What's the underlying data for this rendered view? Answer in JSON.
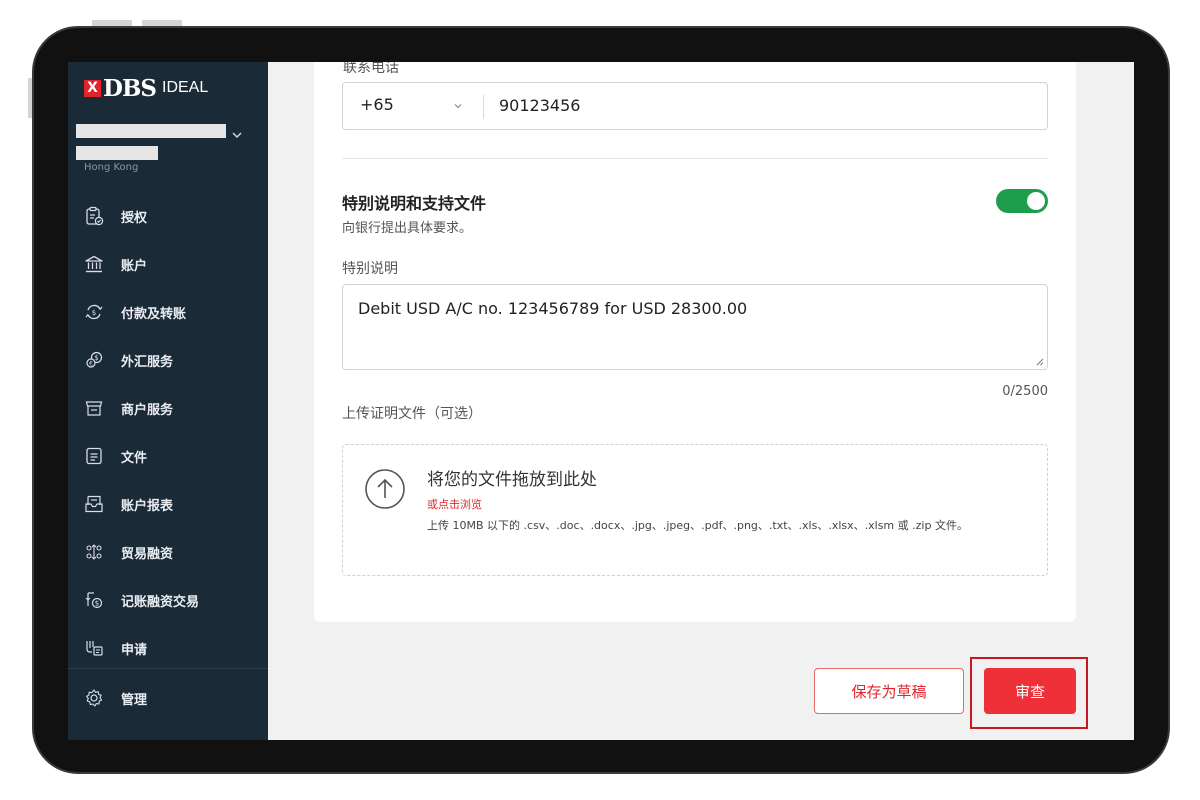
{
  "brand": {
    "logo_mark": "X",
    "logo_dbs": "DBS",
    "logo_ideal": "IDEAL",
    "accent": "#e3232b"
  },
  "sidebar": {
    "region": "Hong Kong",
    "items": [
      {
        "label": "授权",
        "icon": "authorize-icon"
      },
      {
        "label": "账户",
        "icon": "bank-icon"
      },
      {
        "label": "付款及转账",
        "icon": "transfer-icon"
      },
      {
        "label": "外汇服务",
        "icon": "fx-icon"
      },
      {
        "label": "商户服务",
        "icon": "merchant-icon"
      },
      {
        "label": "文件",
        "icon": "file-icon"
      },
      {
        "label": "账户报表",
        "icon": "report-icon"
      },
      {
        "label": "贸易融资",
        "icon": "trade-icon"
      },
      {
        "label": "记账融资交易",
        "icon": "financing-icon"
      },
      {
        "label": "申请",
        "icon": "apply-icon"
      }
    ],
    "admin": {
      "label": "管理",
      "icon": "gear-icon"
    }
  },
  "form": {
    "phone_label": "联系电话",
    "phone_code": "+65",
    "phone_number": "90123456",
    "section_title": "特别说明和支持文件",
    "section_subtitle": "向银行提出具体要求。",
    "toggle_on": true,
    "remark_label": "特别说明",
    "remark_value": "Debit USD A/C no. 123456789 for USD 28300.00",
    "counter": "0/2500",
    "upload_label": "上传证明文件（可选）",
    "upload": {
      "title": "将您的文件拖放到此处",
      "browse": "或点击浏览",
      "types": "上传 10MB 以下的 .csv、.doc、.docx、.jpg、.jpeg、.pdf、.png、.txt、.xls、.xlsx、.xlsm 或 .zip 文件。"
    }
  },
  "actions": {
    "save_draft": "保存为草稿",
    "review": "审查"
  },
  "colors": {
    "sidebar_bg": "#1b2a37",
    "toggle": "#1e9e4d",
    "primary": "#ee3138",
    "highlight": "#c7181f"
  }
}
